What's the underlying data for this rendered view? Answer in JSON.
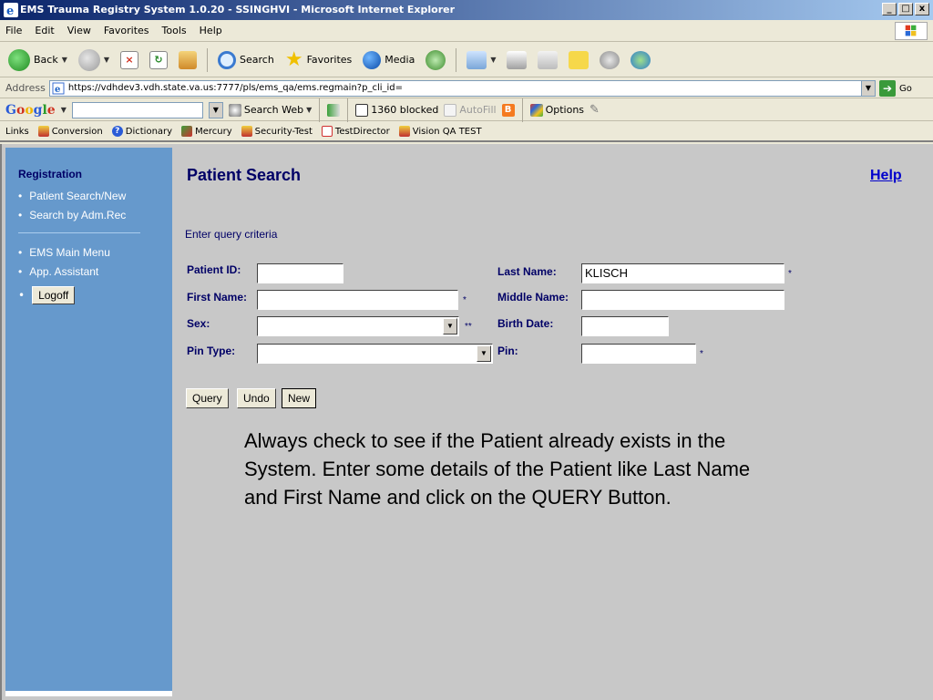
{
  "window": {
    "title": "EMS Trauma Registry System 1.0.20 - SSINGHVI - Microsoft Internet Explorer",
    "minimize": "_",
    "maximize": "□",
    "close": "x"
  },
  "menu": [
    "File",
    "Edit",
    "View",
    "Favorites",
    "Tools",
    "Help"
  ],
  "toolbar": {
    "back": "Back",
    "search": "Search",
    "favorites": "Favorites",
    "media": "Media"
  },
  "address": {
    "label": "Address",
    "url": "https://vdhdev3.vdh.state.va.us:7777/pls/ems_qa/ems.regmain?p_cli_id=",
    "go": "Go"
  },
  "googlebar": {
    "search_web": "Search Web",
    "blocked": "1360 blocked",
    "autofill": "AutoFill",
    "options": "Options"
  },
  "links": {
    "label": "Links",
    "items": [
      "Conversion",
      "Dictionary",
      "Mercury",
      "Security-Test",
      "TestDirector",
      "Vision QA TEST"
    ]
  },
  "sidebar": {
    "heading": "Registration",
    "group1": [
      "Patient Search/New",
      "Search by Adm.Rec"
    ],
    "group2": [
      "EMS Main Menu",
      "App. Assistant"
    ],
    "logoff": "Logoff"
  },
  "main": {
    "title": "Patient Search",
    "help": "Help",
    "hint": "Enter query criteria",
    "fields": {
      "patient_id": {
        "label": "Patient ID:",
        "value": ""
      },
      "first_name": {
        "label": "First Name:",
        "value": "",
        "req": "*"
      },
      "sex": {
        "label": "Sex:",
        "value": "",
        "req": "**"
      },
      "pin_type": {
        "label": "Pin Type:",
        "value": ""
      },
      "last_name": {
        "label": "Last Name:",
        "value": "KLISCH",
        "req": "*"
      },
      "middle_name": {
        "label": "Middle Name:",
        "value": ""
      },
      "birth_date": {
        "label": "Birth Date:",
        "value": ""
      },
      "pin": {
        "label": "Pin:",
        "value": "",
        "req": "*"
      }
    },
    "buttons": {
      "query": "Query",
      "undo": "Undo",
      "new": "New"
    },
    "instructions": "Always check to see if the Patient already exists in the System. Enter some details of the Patient like Last Name and First Name and click on the QUERY Button."
  },
  "colors": {
    "sidebar_bg": "#6699cc",
    "content_bg": "#c8c8c8",
    "label_color": "#000066",
    "link_color": "#0000cc"
  }
}
